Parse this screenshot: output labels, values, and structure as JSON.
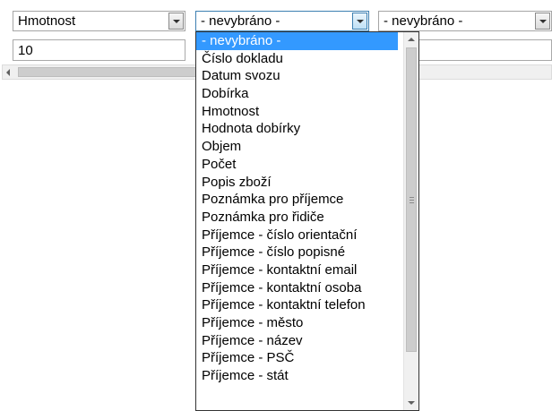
{
  "selects": [
    {
      "value": "Hmotnost"
    },
    {
      "value": "- nevybráno -"
    },
    {
      "value": "- nevybráno -"
    }
  ],
  "inputs": [
    {
      "value": "10"
    },
    {
      "value": ""
    }
  ],
  "dropdown": {
    "options": [
      "- nevybráno -",
      "Číslo dokladu",
      "Datum svozu",
      "Dobírka",
      "Hmotnost",
      "Hodnota dobírky",
      "Objem",
      "Počet",
      "Popis zboží",
      "Poznámka pro příjemce",
      "Poznámka pro řidiče",
      "Příjemce - číslo orientační",
      "Příjemce - číslo popisné",
      "Příjemce - kontaktní email",
      "Příjemce - kontaktní osoba",
      "Příjemce - kontaktní telefon",
      "Příjemce - město",
      "Příjemce - název",
      "Příjemce - PSČ",
      "Příjemce - stát"
    ],
    "selected": "- nevybráno -"
  }
}
